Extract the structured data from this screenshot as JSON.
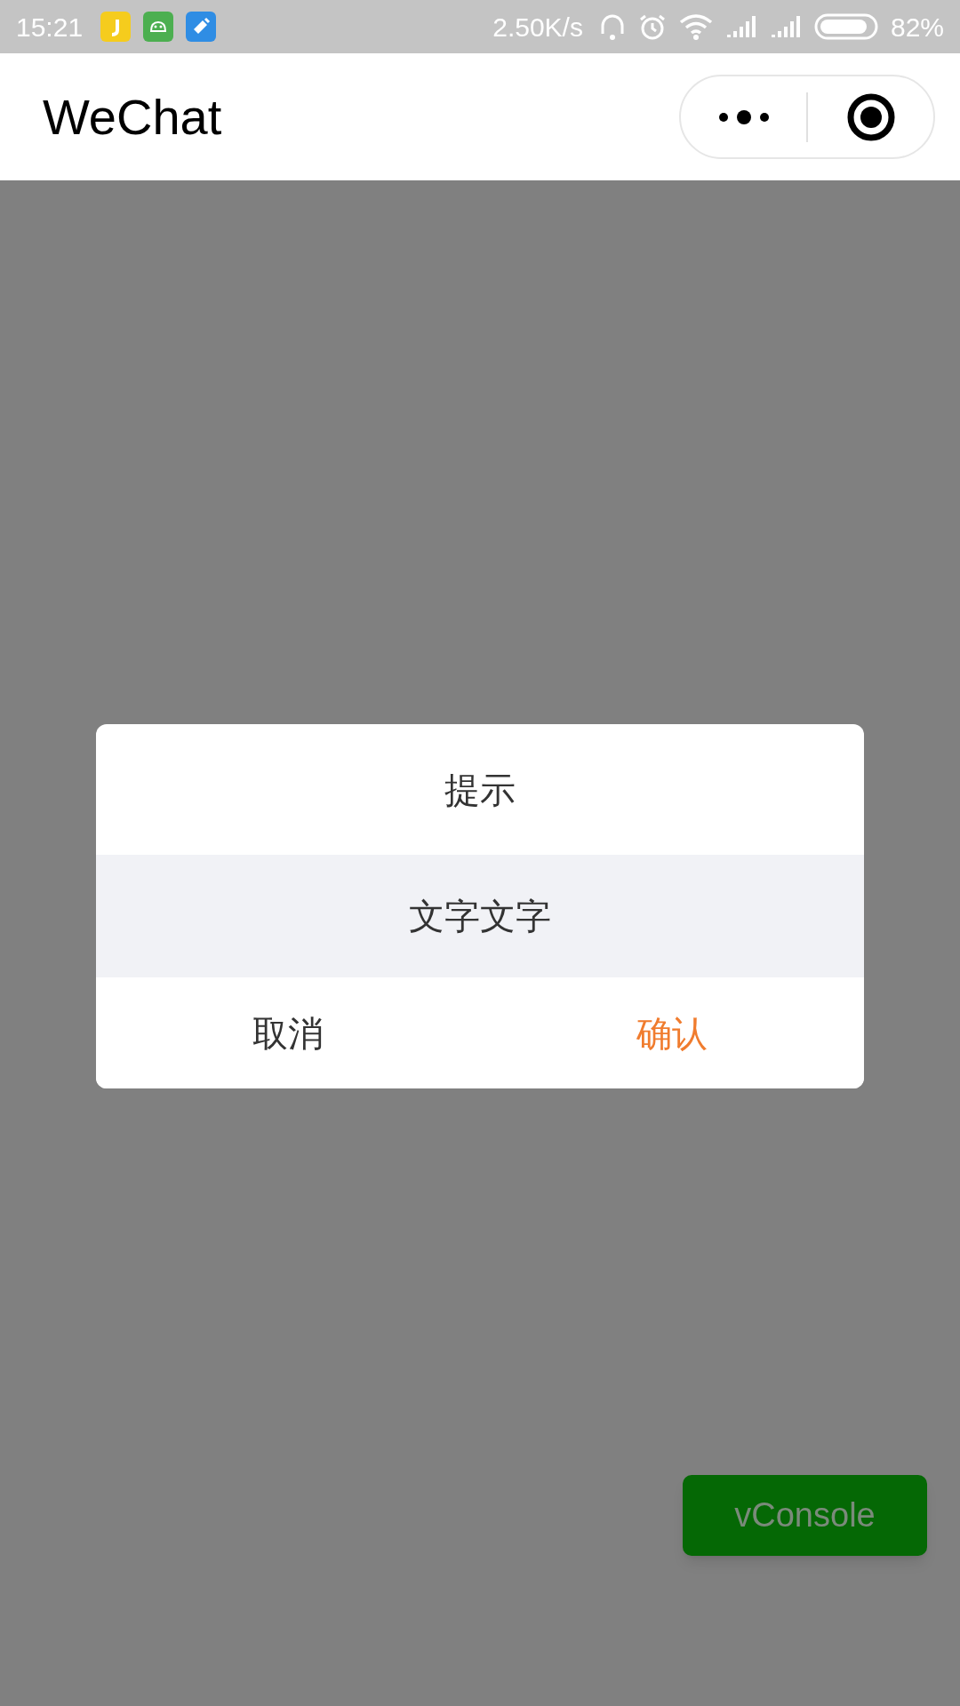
{
  "status_bar": {
    "time": "15:21",
    "network_speed": "2.50K/s",
    "battery": "82%"
  },
  "nav_bar": {
    "title": "WeChat"
  },
  "dialog": {
    "title": "提示",
    "message": "文字文字",
    "buttons": [
      {
        "label": "取消",
        "kind": "cancel"
      },
      {
        "label": "确认",
        "kind": "confirm"
      }
    ]
  },
  "floating_button": {
    "label": "vConsole"
  }
}
